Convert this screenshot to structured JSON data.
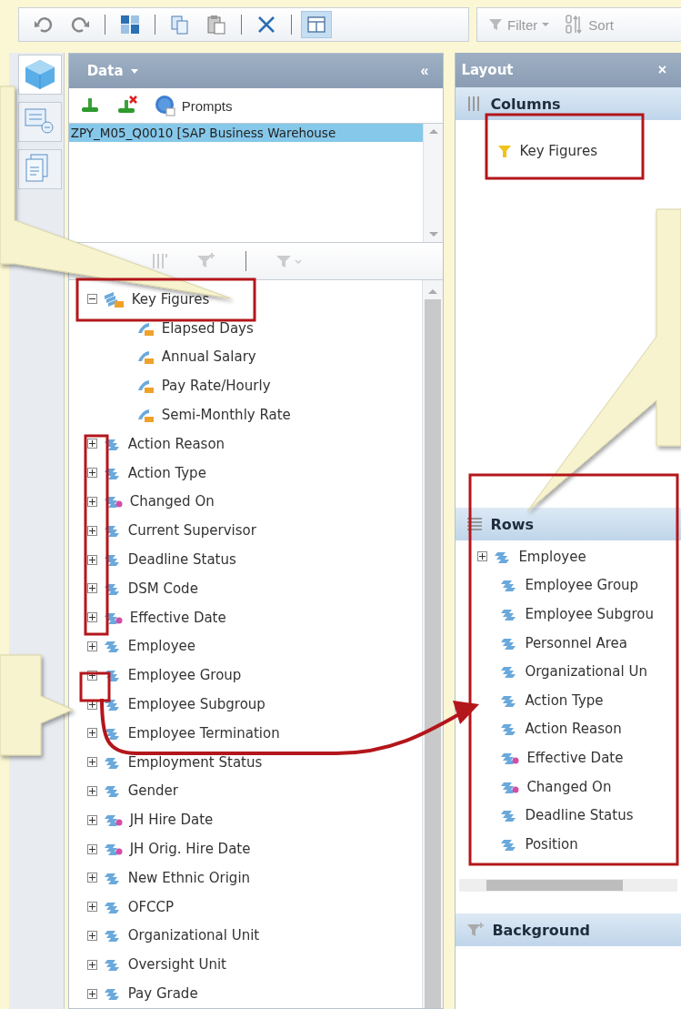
{
  "toolbar": {
    "groups": [
      [
        {
          "kind": "undo",
          "selected": false
        },
        {
          "kind": "redo",
          "selected": false
        }
      ],
      [
        {
          "kind": "swap",
          "selected": false
        }
      ],
      [
        {
          "kind": "copy",
          "selected": false
        },
        {
          "kind": "paste",
          "selected": false
        }
      ],
      [
        {
          "kind": "delete",
          "selected": false
        }
      ],
      [
        {
          "kind": "layout",
          "selected": true
        }
      ]
    ],
    "filter": "Filter",
    "sort": "Sort"
  },
  "side_tabs": [
    {
      "kind": "data",
      "selected": true
    },
    {
      "kind": "query",
      "selected": false
    },
    {
      "kind": "document",
      "selected": false
    }
  ],
  "data_panel": {
    "title": "Data",
    "collapse": "«",
    "prompts": "Prompts",
    "queries": [
      {
        "label": "ZPY_M05_Q0010 [SAP Business Warehouse",
        "selected": true
      }
    ],
    "tree": [
      {
        "label": "Key Figures",
        "kind": "measures",
        "expanded": true,
        "children": [
          {
            "label": "Elapsed Days",
            "kind": "measure"
          },
          {
            "label": "Annual Salary",
            "kind": "measure"
          },
          {
            "label": "Pay Rate/Hourly",
            "kind": "measure"
          },
          {
            "label": "Semi-Monthly Rate",
            "kind": "measure"
          }
        ]
      },
      {
        "label": "Action Reason",
        "kind": "dimension",
        "expanded": false
      },
      {
        "label": "Action Type",
        "kind": "dimension",
        "expanded": false
      },
      {
        "label": "Changed On",
        "kind": "date",
        "expanded": false
      },
      {
        "label": "Current Supervisor",
        "kind": "dimension",
        "expanded": false
      },
      {
        "label": "Deadline Status",
        "kind": "dimension",
        "expanded": false
      },
      {
        "label": "DSM Code",
        "kind": "dimension",
        "expanded": false
      },
      {
        "label": "Effective Date",
        "kind": "date",
        "expanded": false
      },
      {
        "label": "Employee",
        "kind": "dimension",
        "expanded": false
      },
      {
        "label": "Employee Group",
        "kind": "dimension",
        "expanded": false
      },
      {
        "label": "Employee Subgroup",
        "kind": "dimension",
        "expanded": false
      },
      {
        "label": "Employee Termination",
        "kind": "dimension",
        "expanded": false
      },
      {
        "label": "Employment Status",
        "kind": "dimension",
        "expanded": false
      },
      {
        "label": "Gender",
        "kind": "dimension",
        "expanded": false
      },
      {
        "label": "JH Hire Date",
        "kind": "date",
        "expanded": false
      },
      {
        "label": "JH Orig. Hire Date",
        "kind": "date",
        "expanded": false
      },
      {
        "label": "New Ethnic Origin",
        "kind": "dimension",
        "expanded": false
      },
      {
        "label": "OFCCP",
        "kind": "dimension",
        "expanded": false
      },
      {
        "label": "Organizational Unit",
        "kind": "dimension",
        "expanded": false
      },
      {
        "label": "Oversight Unit",
        "kind": "dimension",
        "expanded": false
      },
      {
        "label": "Pay Grade",
        "kind": "dimension",
        "expanded": false
      }
    ]
  },
  "layout_panel": {
    "title": "Layout",
    "close": "×",
    "columns_title": "Columns",
    "columns": [
      {
        "label": "Key Figures",
        "kind": "filter"
      }
    ],
    "rows_title": "Rows",
    "rows": [
      {
        "label": "Employee",
        "kind": "dimension",
        "expanded": false
      },
      {
        "label": "Employee Group",
        "kind": "dimension"
      },
      {
        "label": "Employee Subgrou",
        "kind": "dimension"
      },
      {
        "label": "Personnel Area",
        "kind": "dimension"
      },
      {
        "label": "Organizational Un",
        "kind": "dimension"
      },
      {
        "label": "Action Type",
        "kind": "dimension"
      },
      {
        "label": "Action Reason",
        "kind": "dimension"
      },
      {
        "label": "Effective Date",
        "kind": "date"
      },
      {
        "label": "Changed On",
        "kind": "date"
      },
      {
        "label": "Deadline Status",
        "kind": "dimension"
      },
      {
        "label": "Position",
        "kind": "dimension"
      }
    ],
    "background_title": "Background"
  }
}
